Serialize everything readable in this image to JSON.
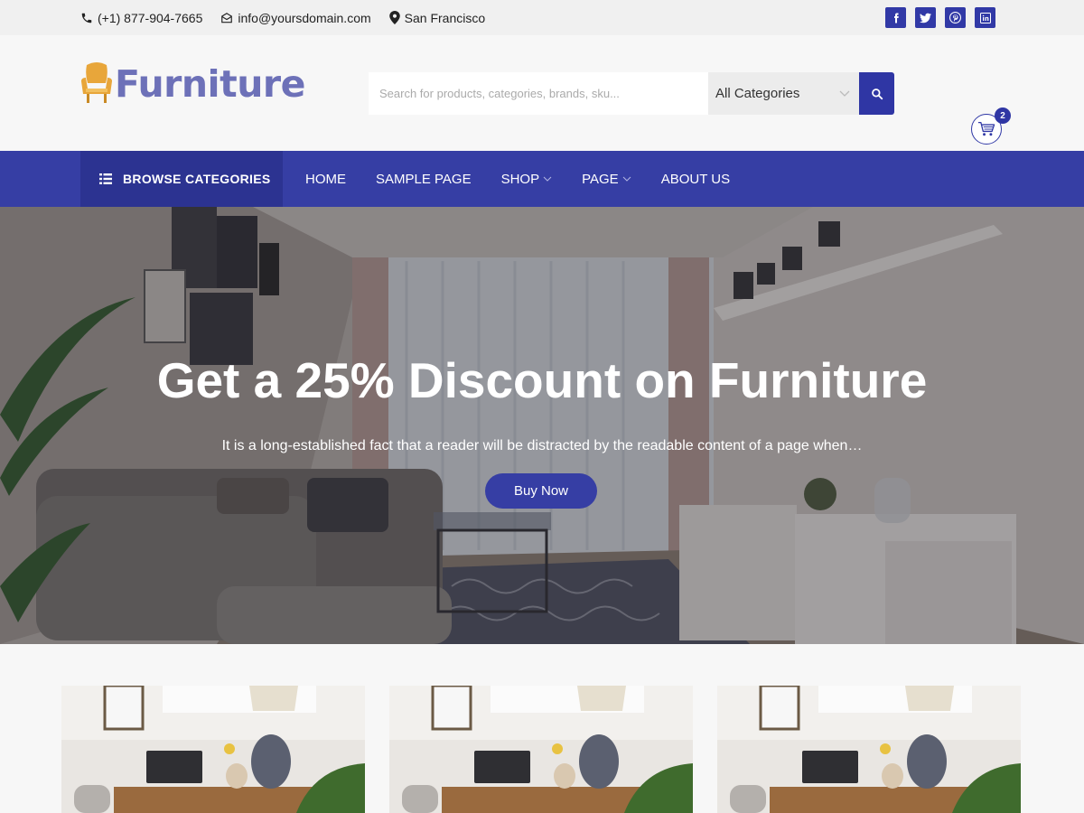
{
  "topbar": {
    "phone": "(+1) 877-904-7665",
    "email": "info@yoursdomain.com",
    "location": "San Francisco",
    "social": [
      {
        "name": "facebook-icon",
        "glyph": "f"
      },
      {
        "name": "twitter-icon",
        "glyph": "t"
      },
      {
        "name": "pinterest-icon",
        "glyph": "p"
      },
      {
        "name": "linkedin-icon",
        "glyph": "in"
      }
    ]
  },
  "header": {
    "logo_text": "Furniture",
    "search_placeholder": "Search for products, categories, brands, sku...",
    "category_select": "All Categories",
    "cart_count": "2"
  },
  "nav": {
    "browse_label": "BROWSE CATEGORIES",
    "items": [
      {
        "label": "HOME",
        "dropdown": false
      },
      {
        "label": "SAMPLE PAGE",
        "dropdown": false
      },
      {
        "label": "SHOP",
        "dropdown": true
      },
      {
        "label": "PAGE",
        "dropdown": true
      },
      {
        "label": "ABOUT US",
        "dropdown": false
      }
    ]
  },
  "hero": {
    "title": "Get a 25% Discount on Furniture",
    "subtitle": "It is a long-established fact that a reader will be distracted by the readable content of a page when…",
    "button": "Buy Now"
  },
  "colors": {
    "brand": "#363ea4",
    "brand_dark": "#2c3391",
    "logo_text": "#6d71b8",
    "logo_icon": "#e8a63a"
  }
}
